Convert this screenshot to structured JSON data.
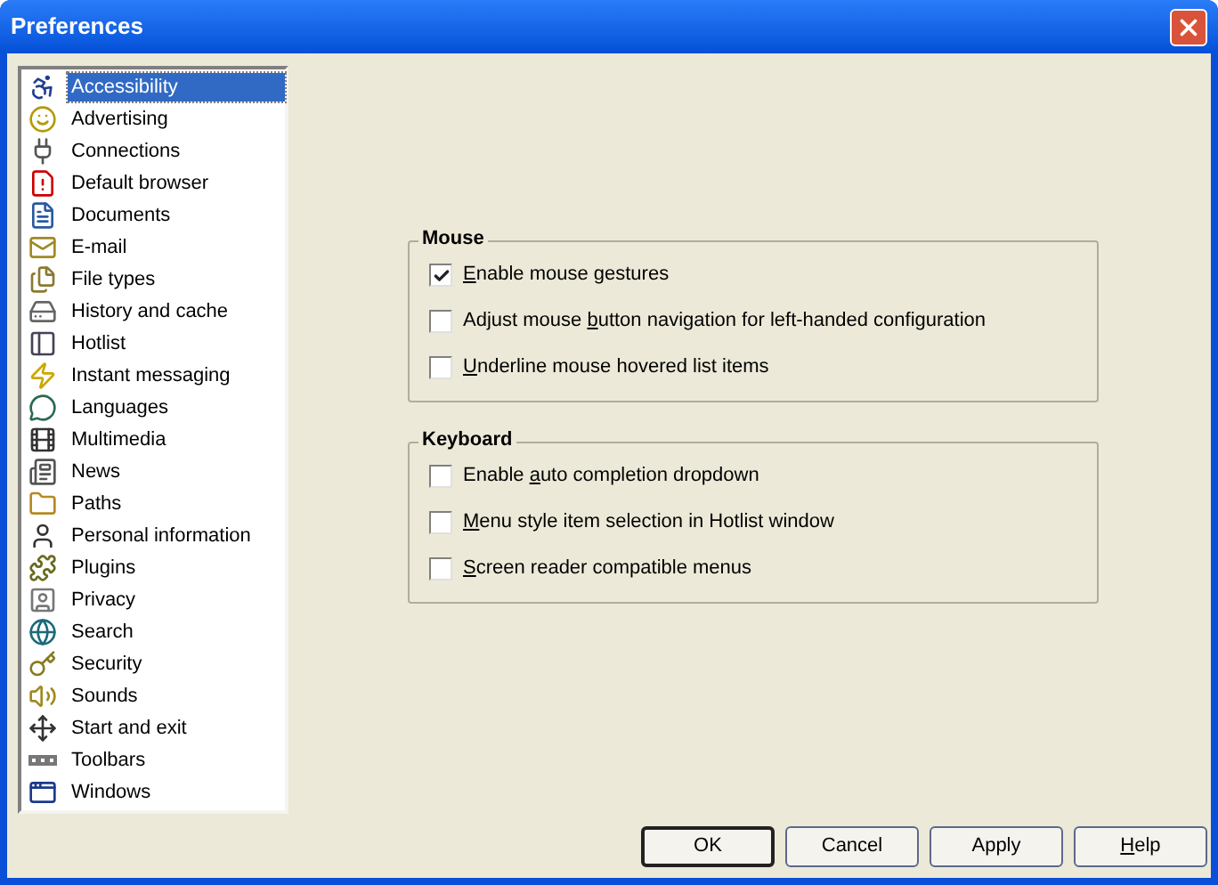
{
  "window": {
    "title": "Preferences"
  },
  "sidebar": {
    "items": [
      {
        "label": "Accessibility",
        "selected": true
      },
      {
        "label": "Advertising",
        "selected": false
      },
      {
        "label": "Connections",
        "selected": false
      },
      {
        "label": "Default browser",
        "selected": false
      },
      {
        "label": "Documents",
        "selected": false
      },
      {
        "label": "E-mail",
        "selected": false
      },
      {
        "label": "File types",
        "selected": false
      },
      {
        "label": "History and cache",
        "selected": false
      },
      {
        "label": "Hotlist",
        "selected": false
      },
      {
        "label": "Instant messaging",
        "selected": false
      },
      {
        "label": "Languages",
        "selected": false
      },
      {
        "label": "Multimedia",
        "selected": false
      },
      {
        "label": "News",
        "selected": false
      },
      {
        "label": "Paths",
        "selected": false
      },
      {
        "label": "Personal information",
        "selected": false
      },
      {
        "label": "Plugins",
        "selected": false
      },
      {
        "label": "Privacy",
        "selected": false
      },
      {
        "label": "Search",
        "selected": false
      },
      {
        "label": "Security",
        "selected": false
      },
      {
        "label": "Sounds",
        "selected": false
      },
      {
        "label": "Start and exit",
        "selected": false
      },
      {
        "label": "Toolbars",
        "selected": false
      },
      {
        "label": "Windows",
        "selected": false
      }
    ]
  },
  "groups": [
    {
      "title": "Mouse",
      "options": [
        {
          "key": "E",
          "post": "nable mouse gestures",
          "checked": true
        },
        {
          "pre": "Adjust mouse ",
          "key": "b",
          "post": "utton navigation for left-handed configuration",
          "checked": false
        },
        {
          "key": "U",
          "post": "nderline mouse hovered list items",
          "checked": false
        }
      ]
    },
    {
      "title": "Keyboard",
      "options": [
        {
          "pre": "Enable ",
          "key": "a",
          "post": "uto completion dropdown",
          "checked": false
        },
        {
          "key": "M",
          "post": "enu style item selection in Hotlist window",
          "checked": false
        },
        {
          "key": "S",
          "post": "creen reader compatible menus",
          "checked": false
        }
      ]
    }
  ],
  "buttons": [
    {
      "pre": "OK",
      "default": true
    },
    {
      "pre": "Cancel",
      "default": false
    },
    {
      "pre": "Apply",
      "default": false
    },
    {
      "key": "H",
      "post": "elp",
      "default": false
    }
  ]
}
